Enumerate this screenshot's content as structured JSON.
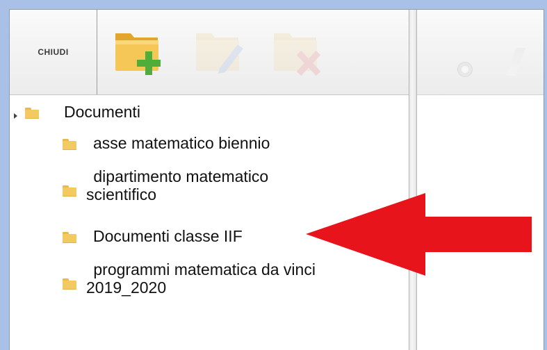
{
  "toolbar": {
    "close_label": "CHIUDI",
    "icons": [
      "folder-add-icon",
      "edit-icon",
      "delete-icon"
    ]
  },
  "tree": {
    "root": {
      "label": "Documenti",
      "icon": "folder-icon"
    },
    "items": [
      {
        "label": "asse matematico biennio"
      },
      {
        "label": " dipartimento matematico",
        "label2": "scientifico"
      },
      {
        "label": "Documenti classe IIF"
      },
      {
        "label": " programmi matematica da vinci",
        "label2": "2019_2020"
      }
    ]
  },
  "annotation": {
    "arrow_color": "#e8141c"
  },
  "colors": {
    "background": "#a9c1e6",
    "folder": "#f3c961"
  }
}
